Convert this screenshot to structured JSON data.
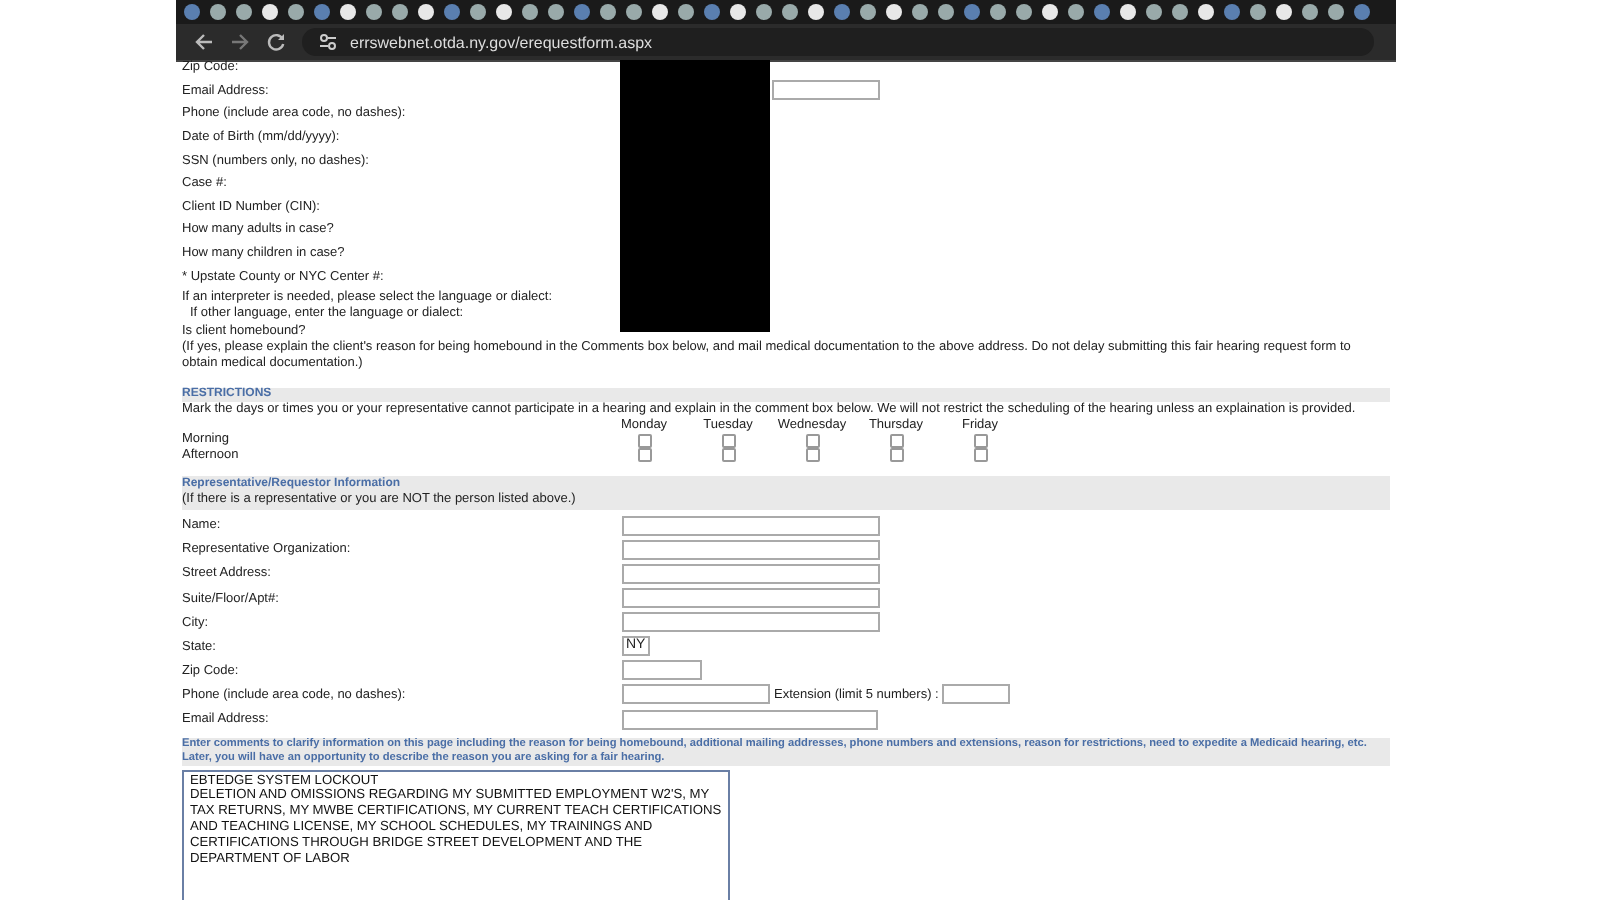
{
  "browser": {
    "url": "errswebnet.otda.ny.gov/erequestform.aspx"
  },
  "client": {
    "fields": [
      {
        "label": "Zip Code:",
        "kind": "plain"
      },
      {
        "label": "Email Address:",
        "kind": "input"
      },
      {
        "label": "Phone (include area code, no dashes):",
        "kind": "plain"
      },
      {
        "label": "Date of Birth (mm/dd/yyyy):",
        "kind": "plain"
      },
      {
        "label": "SSN (numbers only, no dashes):",
        "kind": "plain"
      },
      {
        "label": "Case #:",
        "kind": "plain"
      },
      {
        "label": "Client ID Number (CIN):",
        "kind": "plain"
      },
      {
        "label": "How many adults in case?",
        "kind": "plain"
      },
      {
        "label": "How many children in case?",
        "kind": "plain"
      },
      {
        "label": "* Upstate County or NYC Center #:",
        "kind": "plain"
      },
      {
        "label": "If an interpreter is needed, please select the language or dialect:",
        "kind": "plain"
      },
      {
        "label": "If other language, enter the language or dialect:",
        "kind": "indented"
      },
      {
        "label": "Is client homebound?",
        "kind": "plain"
      }
    ],
    "note": "(If yes, please explain the client's reason for being homebound in the Comments box below, and mail medical documentation to the above address. Do not delay submitting this fair hearing request form to obtain medical documentation.)"
  },
  "restrictions": {
    "title": "RESTRICTIONS",
    "text": "Mark the days or times you or your representative cannot participate in a hearing and explain in the comment box below. We will not restrict the scheduling of the hearing unless an explaination is provided.",
    "days": [
      "Monday",
      "Tuesday",
      "Wednesday",
      "Thursday",
      "Friday"
    ],
    "periods": [
      {
        "label": "Morning",
        "slots": [
          {
            "checked": false
          },
          {
            "checked": false
          },
          {
            "checked": false
          },
          {
            "checked": false
          },
          {
            "checked": false
          }
        ]
      },
      {
        "label": "Afternoon",
        "slots": [
          {
            "checked": false
          },
          {
            "checked": false
          },
          {
            "checked": false
          },
          {
            "checked": false
          },
          {
            "checked": false
          }
        ]
      }
    ]
  },
  "representative": {
    "title": "Representative/Requestor Information",
    "note": "(If there is a representative or you are NOT the person listed above.)",
    "fields": [
      {
        "label": "Name:",
        "kind": "wide"
      },
      {
        "label": "Representative Organization:",
        "kind": "wide"
      },
      {
        "label": "Street Address:",
        "kind": "wide"
      },
      {
        "label": "Suite/Floor/Apt#:",
        "kind": "wide"
      },
      {
        "label": "City:",
        "kind": "wide"
      },
      {
        "label": "State:",
        "kind": "state",
        "value": "NY"
      },
      {
        "label": "Zip Code:",
        "kind": "zip"
      },
      {
        "label": "Phone (include area code, no dashes):",
        "kind": "phone",
        "extension_label": "Extension (limit 5 numbers) :"
      },
      {
        "label": "Email Address:",
        "kind": "email"
      }
    ]
  },
  "comments": {
    "instructions": "Enter comments to clarify information on this page including the reason for being homebound, additional mailing addresses, phone numbers and extensions, reason for restrictions, need to expedite a Medicaid hearing, etc. Later, you will have an opportunity to describe the reason you are asking for a fair hearing.",
    "value": "EBTEDGE SYSTEM LOCKOUT\nDELETION AND OMISSIONS REGARDING MY SUBMITTED EMPLOYMENT W2'S, MY TAX RETURNS, MY MWBE CERTIFICATIONS, MY CURRENT TEACH CERTIFICATIONS AND TEACHING LICENSE, MY SCHOOL SCHEDULES, MY TRAININGS AND CERTIFICATIONS THROUGH BRIDGE STREET DEVELOPMENT AND THE DEPARTMENT OF LABOR"
  }
}
